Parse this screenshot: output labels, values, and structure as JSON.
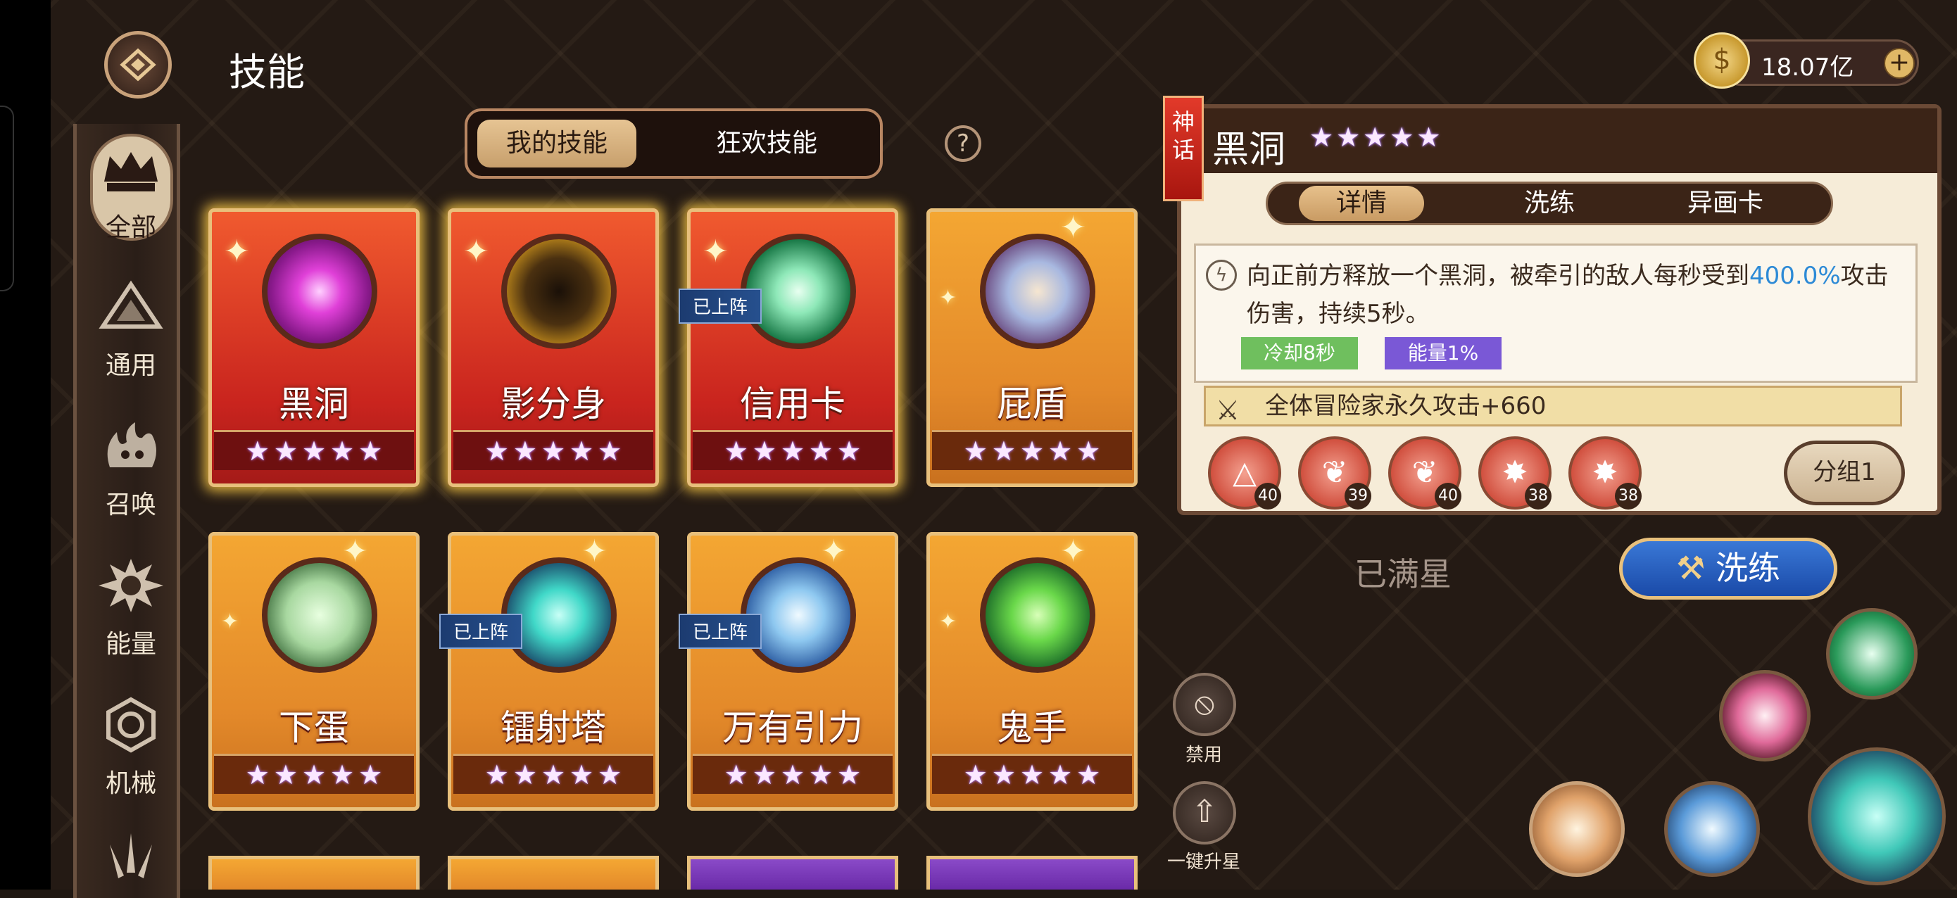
{
  "page": {
    "title": "技能"
  },
  "sidenav": [
    {
      "label": "全部",
      "icon": "crown-icon",
      "active": true
    },
    {
      "label": "通用",
      "icon": "triangle-emblem-icon"
    },
    {
      "label": "召唤",
      "icon": "summon-flame-icon"
    },
    {
      "label": "能量",
      "icon": "energy-burst-icon"
    },
    {
      "label": "机械",
      "icon": "gear-icon"
    }
  ],
  "tabs": {
    "my_skills": "我的技能",
    "carnival_skills": "狂欢技能",
    "help": "?"
  },
  "cards": [
    {
      "name": "黑洞",
      "color": "red",
      "stars": 5,
      "deployed": false,
      "selected": true
    },
    {
      "name": "影分身",
      "color": "red",
      "stars": 5,
      "deployed": false
    },
    {
      "name": "信用卡",
      "color": "red",
      "stars": 5,
      "deployed": true
    },
    {
      "name": "屁盾",
      "color": "orange",
      "stars": 5,
      "deployed": false
    },
    {
      "name": "下蛋",
      "color": "orange",
      "stars": 5,
      "deployed": false
    },
    {
      "name": "镭射塔",
      "color": "orange",
      "stars": 5,
      "deployed": true
    },
    {
      "name": "万有引力",
      "color": "orange",
      "stars": 5,
      "deployed": true
    },
    {
      "name": "鬼手",
      "color": "orange",
      "stars": 5,
      "deployed": false
    }
  ],
  "deployed_label": "已上阵",
  "currency": {
    "value": "18.07亿",
    "plus": "+"
  },
  "detail": {
    "rarity": "神话",
    "name": "黑洞",
    "stars": 5,
    "tabs": [
      "详情",
      "洗练",
      "异画卡"
    ],
    "description_before": "向正前方释放一个黑洞，被牵引的敌人每秒受到",
    "description_highlight": "400.0%",
    "description_after": "攻击伤害，持续5秒。",
    "cooldown": "冷却8秒",
    "energy": "能量1%",
    "attribute": "全体冒险家永久攻击+660",
    "runes": [
      {
        "level": "40",
        "icon": "triangle-rune-icon"
      },
      {
        "level": "39",
        "icon": "leaf-rune-icon"
      },
      {
        "level": "40",
        "icon": "leaf-rune-icon"
      },
      {
        "level": "38",
        "icon": "burst-rune-icon"
      },
      {
        "level": "38",
        "icon": "burst-rune-icon"
      }
    ],
    "group_button": "分组1",
    "max_star": "已满星",
    "refine_button": "洗练"
  },
  "tools": {
    "ban": "禁用",
    "upgrade_all": "一键升星"
  },
  "colors": {
    "accent_gold": "#e8c07c",
    "card_red": "#c9241e",
    "card_orange": "#e3892a",
    "highlight_blue": "#2d8ad6",
    "cooldown_green": "#6fbf5e",
    "energy_purple": "#7a58d6"
  }
}
